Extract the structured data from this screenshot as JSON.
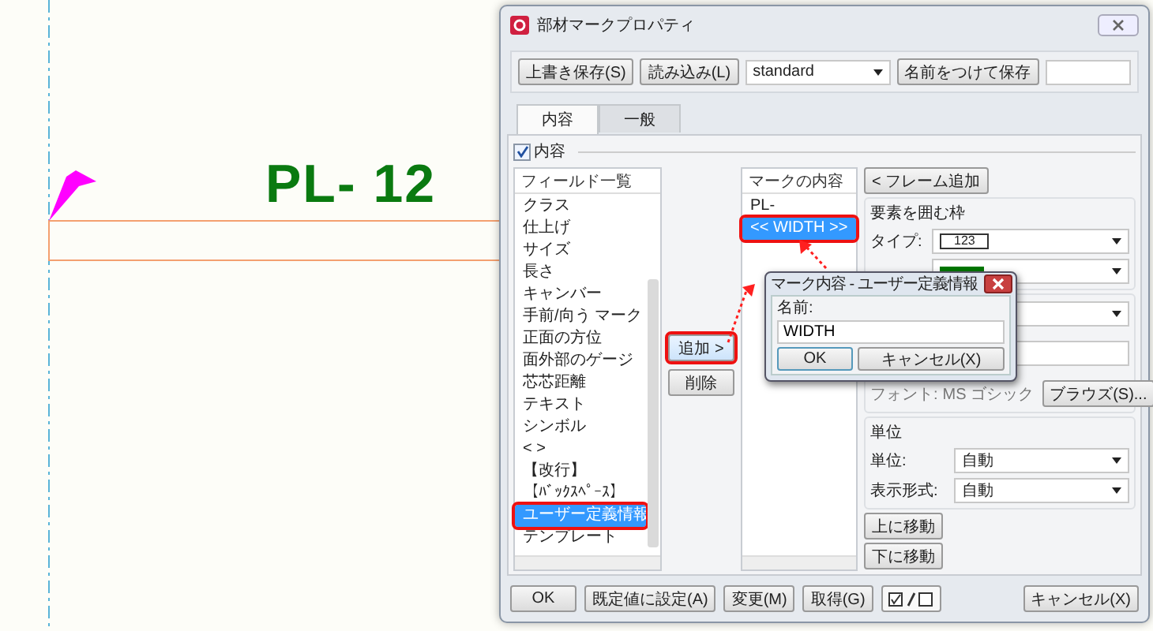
{
  "canvas": {
    "mark_text": "PL- 12"
  },
  "window": {
    "title": "部材マークプロパティ"
  },
  "toolbar": {
    "buttons": [
      "上書き保存(S)",
      "読み込み(L)"
    ],
    "preset": "standard",
    "save_as": "名前をつけて保存"
  },
  "tabs": [
    {
      "label": "内容",
      "selected": true
    },
    {
      "label": "一般",
      "selected": false
    }
  ],
  "content_checkbox": {
    "label": "内容",
    "checked": true
  },
  "field_list": {
    "header": "フィールド一覧",
    "items": [
      {
        "label": "クラス",
        "selected": false
      },
      {
        "label": "仕上げ",
        "selected": false
      },
      {
        "label": "サイズ",
        "selected": false
      },
      {
        "label": "長さ",
        "selected": false
      },
      {
        "label": "キャンバー",
        "selected": false
      },
      {
        "label": "手前/向う マーク",
        "selected": false
      },
      {
        "label": "正面の方位",
        "selected": false
      },
      {
        "label": "面外部のゲージ",
        "selected": false
      },
      {
        "label": "芯芯距離",
        "selected": false
      },
      {
        "label": "テキスト",
        "selected": false
      },
      {
        "label": "シンボル",
        "selected": false
      },
      {
        "label": "< >",
        "selected": false
      },
      {
        "label": "【改行】",
        "selected": false
      },
      {
        "label": "【ﾊﾞｯｸｽﾍﾟｰｽ】",
        "selected": false
      },
      {
        "label": "ユーザー定義情報",
        "selected": true
      },
      {
        "label": "テンプレート",
        "selected": false
      }
    ]
  },
  "add_button": {
    "label": "追加 >",
    "highlighted": true
  },
  "remove_button": "削除",
  "mark_contents": {
    "header": "マークの内容",
    "items": [
      {
        "label": "PL-",
        "selected": false
      },
      {
        "label": "<< WIDTH >>",
        "selected": true
      }
    ]
  },
  "frame_add_button": "< フレーム追加",
  "frame_group": {
    "title": "要素を囲む枠",
    "type_label": "タイプ:",
    "type_value": "123",
    "color": "#007700"
  },
  "font_row": {
    "label": "フォント:",
    "value": "MS ゴシック",
    "browse": "ブラウズ(S)..."
  },
  "unit_group": {
    "title": "単位",
    "rows": [
      {
        "label": "単位:",
        "value": "自動"
      },
      {
        "label": "表示形式:",
        "value": "自動"
      }
    ]
  },
  "move_buttons": [
    "上に移動",
    "下に移動"
  ],
  "bottom_buttons": [
    "OK",
    "既定値に設定(A)",
    "変更(M)",
    "取得(G)"
  ],
  "cancel_button": "キャンセル(X)",
  "popup": {
    "title": "マーク内容 - ユーザー定義情報",
    "label": "名前:",
    "value": "WIDTH",
    "ok": "OK",
    "cancel": "キャンセル(X)"
  }
}
